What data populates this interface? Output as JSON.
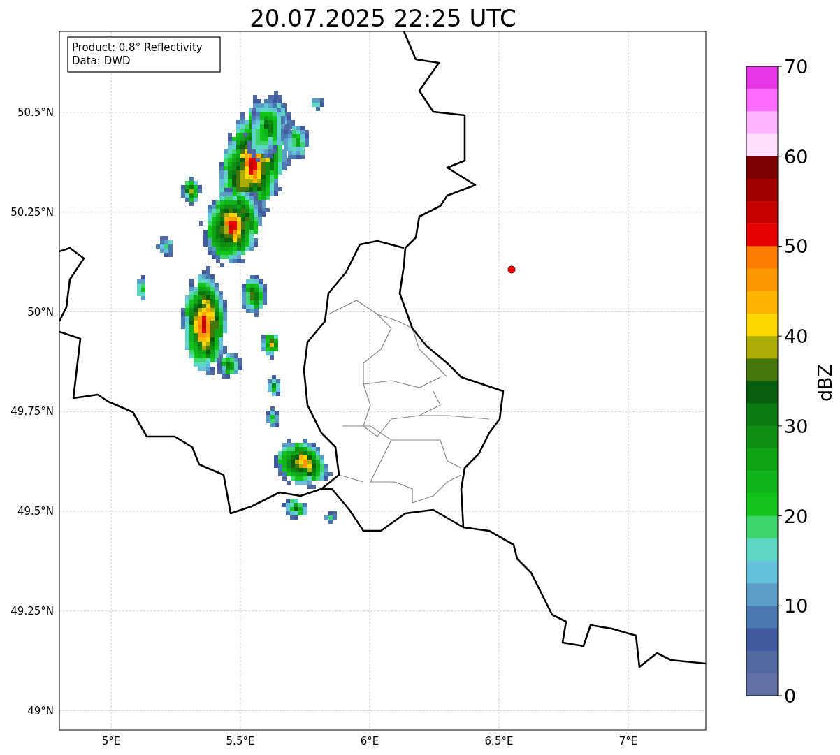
{
  "title": "20.07.2025 22:25 UTC",
  "info_box": [
    "Product: 0.8° Reflectivity",
    "Data: DWD"
  ],
  "map": {
    "xticks": [
      "5°E",
      "5.5°E",
      "6°E",
      "6.5°E",
      "7°E"
    ],
    "yticks": [
      "50.5°N",
      "50.25°N",
      "50°N",
      "49.75°N",
      "49.5°N",
      "49.25°N",
      "49°N"
    ]
  },
  "colorbar": {
    "label": "dBZ",
    "ticks": [
      "70",
      "60",
      "50",
      "40",
      "30",
      "20",
      "10",
      "0"
    ],
    "segments": [
      {
        "color": "#e636e6"
      },
      {
        "color": "#ff6cff"
      },
      {
        "color": "#ffb4ff"
      },
      {
        "color": "#ffe0ff"
      },
      {
        "color": "#7c0000"
      },
      {
        "color": "#a00000"
      },
      {
        "color": "#c40000"
      },
      {
        "color": "#e60000"
      },
      {
        "color": "#fe7c00"
      },
      {
        "color": "#fe9800"
      },
      {
        "color": "#feb400"
      },
      {
        "color": "#fed600"
      },
      {
        "color": "#acac04"
      },
      {
        "color": "#44760c"
      },
      {
        "color": "#085e0e"
      },
      {
        "color": "#0b7a12"
      },
      {
        "color": "#0e8e12"
      },
      {
        "color": "#10a414"
      },
      {
        "color": "#10b41a"
      },
      {
        "color": "#12c41a"
      },
      {
        "color": "#3ed46e"
      },
      {
        "color": "#5ed6c4"
      },
      {
        "color": "#64c2dc"
      },
      {
        "color": "#5a9ec8"
      },
      {
        "color": "#4a78b0"
      },
      {
        "color": "#41599f"
      },
      {
        "color": "#52699f"
      },
      {
        "color": "#6272a8"
      }
    ]
  }
}
